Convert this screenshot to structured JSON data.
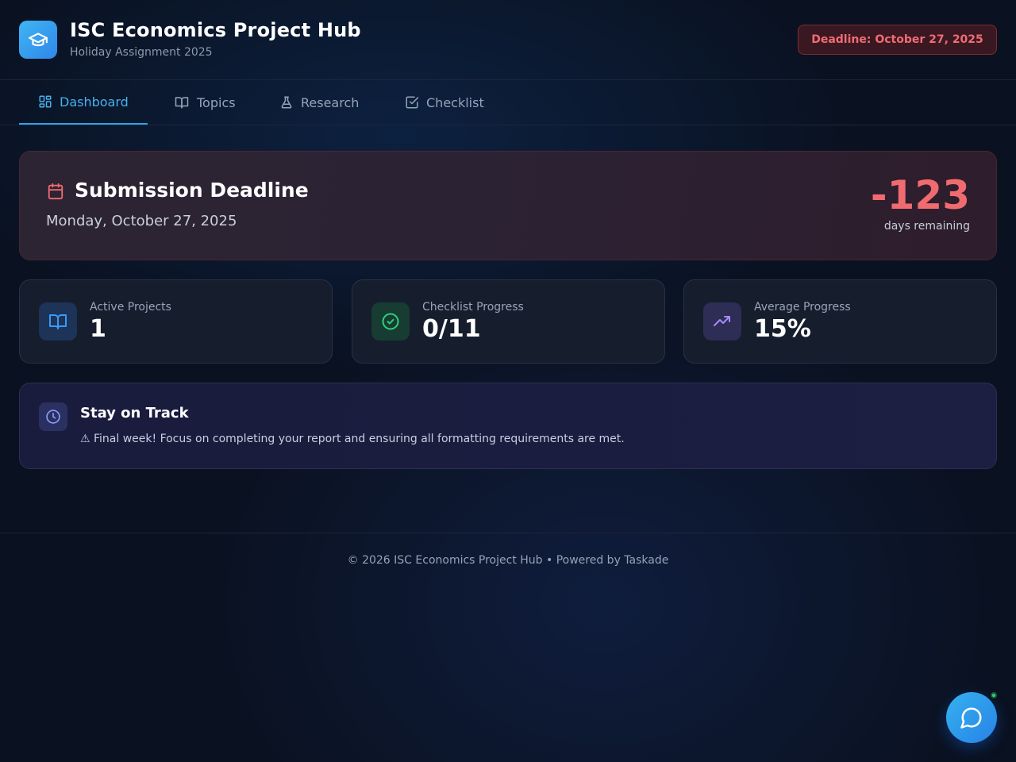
{
  "header": {
    "title": "ISC Economics Project Hub",
    "subtitle": "Holiday Assignment 2025",
    "deadline_badge": "Deadline: October 27, 2025",
    "logo_icon": "graduation-cap-icon"
  },
  "tabs": [
    {
      "label": "Dashboard",
      "icon": "dashboard-grid-icon",
      "active": true
    },
    {
      "label": "Topics",
      "icon": "book-open-icon",
      "active": false
    },
    {
      "label": "Research",
      "icon": "flask-icon",
      "active": false
    },
    {
      "label": "Checklist",
      "icon": "checkbox-icon",
      "active": false
    }
  ],
  "deadline_card": {
    "title": "Submission Deadline",
    "date": "Monday, October 27, 2025",
    "days_value": "-123",
    "days_label": "days remaining",
    "icon": "calendar-icon"
  },
  "stats": [
    {
      "label": "Active Projects",
      "value": "1",
      "icon": "book-open-icon",
      "color": "#3b82f6"
    },
    {
      "label": "Checklist Progress",
      "value": "0/11",
      "icon": "check-circle-icon",
      "color": "#22c55e"
    },
    {
      "label": "Average Progress",
      "value": "15%",
      "icon": "trending-up-icon",
      "color": "#a78bfa"
    }
  ],
  "track": {
    "title": "Stay on Track",
    "message": "⚠ Final week! Focus on completing your report and ensuring all formatting requirements are met.",
    "icon": "clock-icon"
  },
  "footer": {
    "text": "© 2026 ISC Economics Project Hub • Powered by Taskade"
  },
  "chat": {
    "icon": "chat-bubble-icon"
  },
  "colors": {
    "background": "#0a1120",
    "accent": "#2ea3e6",
    "danger": "#f06b6f"
  }
}
